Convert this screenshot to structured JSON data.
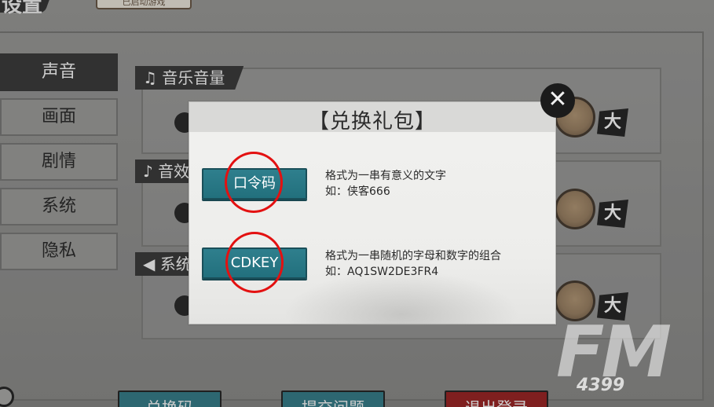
{
  "background": {
    "top_title": "设置",
    "top_badge": "已启动游戏",
    "tabs": [
      {
        "label": "声音",
        "active": true
      },
      {
        "label": "画面",
        "active": false
      },
      {
        "label": "剧情",
        "active": false
      },
      {
        "label": "系统",
        "active": false
      },
      {
        "label": "隐私",
        "active": false
      }
    ],
    "sections": [
      {
        "label": "音乐音量",
        "icon": "music-note-icon"
      },
      {
        "label": "音效",
        "icon": "note-icon"
      },
      {
        "label": "系统",
        "icon": "speaker-icon"
      }
    ],
    "knob_label": "大",
    "bottom_buttons": [
      {
        "label": "兑换码",
        "color": "#2b6f7b"
      },
      {
        "label": "提交问题",
        "color": "#2b6f7b"
      },
      {
        "label": "退出登录",
        "color": "#8b1a1a"
      }
    ]
  },
  "dialog": {
    "title": "【兑换礼包】",
    "close_icon": "close-icon",
    "options": [
      {
        "button_label": "口令码",
        "desc_line1": "格式为一串有意义的文字",
        "desc_line2": "如：侠客666"
      },
      {
        "button_label": "CDKEY",
        "desc_line1": "格式为一串随机的字母和数字的组合",
        "desc_line2": "如：AQ1SW2DE3FR4"
      }
    ]
  },
  "watermark": {
    "big": "FM",
    "small": "4399"
  },
  "colors": {
    "accent_teal": "#2f7f8d",
    "highlight_ring": "#e31111"
  }
}
